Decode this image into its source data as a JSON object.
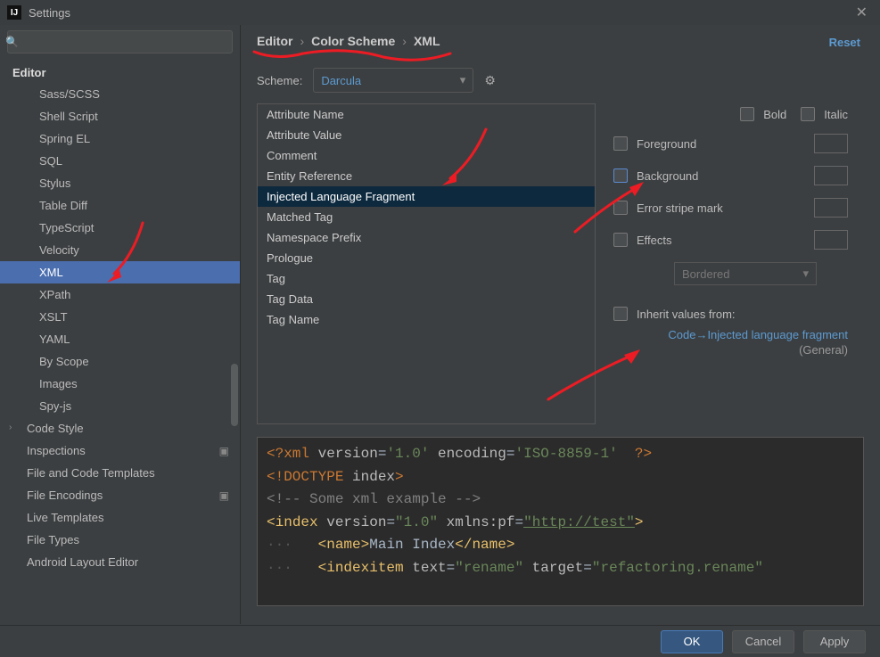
{
  "window": {
    "title": "Settings"
  },
  "search": {
    "placeholder": ""
  },
  "sidebar": {
    "heading": "Editor",
    "items": [
      {
        "label": "Sass/SCSS",
        "depth": 2
      },
      {
        "label": "Shell Script",
        "depth": 2
      },
      {
        "label": "Spring EL",
        "depth": 2
      },
      {
        "label": "SQL",
        "depth": 2
      },
      {
        "label": "Stylus",
        "depth": 2
      },
      {
        "label": "Table Diff",
        "depth": 2
      },
      {
        "label": "TypeScript",
        "depth": 2
      },
      {
        "label": "Velocity",
        "depth": 2
      },
      {
        "label": "XML",
        "depth": 2,
        "selected": true
      },
      {
        "label": "XPath",
        "depth": 2
      },
      {
        "label": "XSLT",
        "depth": 2
      },
      {
        "label": "YAML",
        "depth": 2
      },
      {
        "label": "By Scope",
        "depth": 2
      },
      {
        "label": "Images",
        "depth": 2
      },
      {
        "label": "Spy-js",
        "depth": 2
      },
      {
        "label": "Code Style",
        "depth": 1,
        "expandable": true
      },
      {
        "label": "Inspections",
        "depth": 1,
        "tool": true
      },
      {
        "label": "File and Code Templates",
        "depth": 1
      },
      {
        "label": "File Encodings",
        "depth": 1,
        "tool": true
      },
      {
        "label": "Live Templates",
        "depth": 1
      },
      {
        "label": "File Types",
        "depth": 1
      },
      {
        "label": "Android Layout Editor",
        "depth": 1
      }
    ]
  },
  "breadcrumb": {
    "a": "Editor",
    "b": "Color Scheme",
    "c": "XML"
  },
  "reset": "Reset",
  "scheme": {
    "label": "Scheme:",
    "value": "Darcula"
  },
  "attributes": [
    "Attribute Name",
    "Attribute Value",
    "Comment",
    "Entity Reference",
    "Injected Language Fragment",
    "Matched Tag",
    "Namespace Prefix",
    "Prologue",
    "Tag",
    "Tag Data",
    "Tag Name"
  ],
  "attr_selected_index": 4,
  "opts": {
    "bold": "Bold",
    "italic": "Italic",
    "foreground": "Foreground",
    "background": "Background",
    "error_stripe": "Error stripe mark",
    "effects": "Effects",
    "effects_type": "Bordered",
    "inherit": "Inherit values from:",
    "inherit_link": "Code→Injected language fragment",
    "inherit_sub": "(General)"
  },
  "preview": {
    "l1a": "<?",
    "l1b": "xml ",
    "l1c": "version",
    "l1d": "=",
    "l1e": "'1.0'",
    "l1f": " encoding",
    "l1g": "=",
    "l1h": "'ISO-8859-1'",
    "l1i": "  ?>",
    "l2a": "<!",
    "l2b": "DOCTYPE ",
    "l2c": "index",
    "l2d": ">",
    "l3": "<!-- Some xml example -->",
    "l4a": "<",
    "l4b": "index ",
    "l4c": "version",
    "l4d": "=",
    "l4e": "\"1.0\"",
    "l4f": " xmlns:",
    "l4g": "pf",
    "l4h": "=",
    "l4i": "\"http://test\"",
    "l4j": ">",
    "l5a": "   <",
    "l5b": "name",
    "l5c": ">",
    "l5d": "Main Index",
    "l5e": "</",
    "l5f": "name",
    "l5g": ">",
    "l6a": "   <",
    "l6b": "indexitem ",
    "l6c": "text",
    "l6d": "=",
    "l6e": "\"rename\"",
    "l6f": " target",
    "l6g": "=",
    "l6h": "\"refactoring.rename\""
  },
  "footer": {
    "ok": "OK",
    "cancel": "Cancel",
    "apply": "Apply"
  }
}
